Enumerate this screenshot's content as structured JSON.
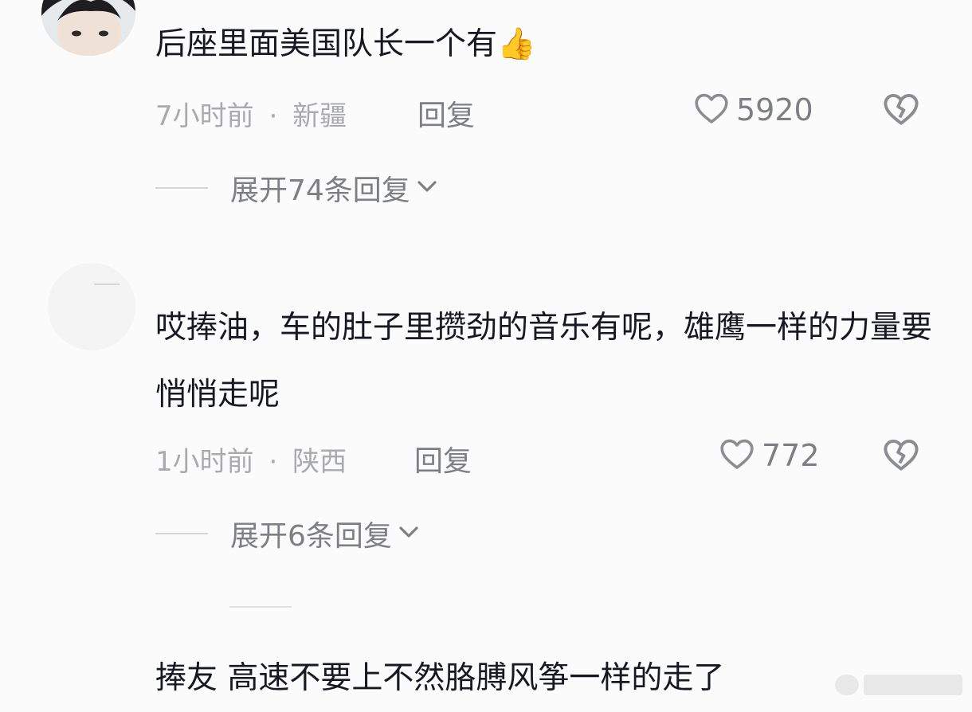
{
  "comments": [
    {
      "text": "后座里面美国队长一个有👍",
      "time": "7小时前",
      "separator": "·",
      "location": "新疆",
      "reply_label": "回复",
      "likes": "5920",
      "expand_label": "展开74条回复"
    },
    {
      "text": "哎捧油，车的肚子里攒劲的音乐有呢，雄鹰一样的力量要悄悄走呢",
      "time": "1小时前",
      "separator": "·",
      "location": "陕西",
      "reply_label": "回复",
      "likes": "772",
      "expand_label": "展开6条回复"
    },
    {
      "text": "捧友 高速不要上不然胳膊风筝一样的走了"
    }
  ],
  "icons": {
    "like": "heart-outline-icon",
    "dislike": "broken-heart-icon",
    "expand": "chevron-down-icon"
  },
  "colors": {
    "text": "#161823",
    "meta": "#a9aaae",
    "action": "#7d7f85",
    "background": "#fbfbfb"
  }
}
